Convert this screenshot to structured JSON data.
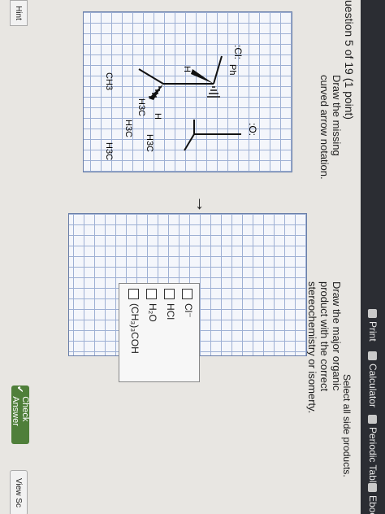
{
  "toolbar": {
    "print": "Print",
    "calculator": "Calculator",
    "periodic_table": "Periodic Table",
    "ebook": "Ebook"
  },
  "question": {
    "header": "uestion 5 of 19 (1 point)",
    "left_instruction_1": "Draw the missing",
    "left_instruction_2": "curved arrow notation.",
    "right_instruction_1": "Draw the major organic",
    "right_instruction_2": "product with the correct",
    "right_instruction_3": "stereochemistry or isomerty.",
    "side_products_label": "Select all side products."
  },
  "molecule": {
    "ch3": "CH3",
    "h3c_wedge": "H3C",
    "h_left": "H",
    "cl": ":Cl:",
    "ph": "Ph",
    "h_bottom": "H",
    "tbu_h3c_1": "H3C",
    "tbu_h3c_2": "H3C",
    "tbu_h3c_3": "H3C",
    "o": ":O:"
  },
  "reaction_arrow": "→",
  "plus": "+",
  "side_products": [
    {
      "label": "Cl⁻"
    },
    {
      "label": "HCl"
    },
    {
      "label": "H₂O"
    },
    {
      "label": "(CH₃)₃COH"
    }
  ],
  "buttons": {
    "check_answer": "Check Answer",
    "view_solution": "View Sc",
    "hint": "Hint"
  },
  "colors": {
    "toolbar_bg": "#2b2d33",
    "check_button": "#4f7f3a",
    "grid_line": "#9eb0d4"
  }
}
